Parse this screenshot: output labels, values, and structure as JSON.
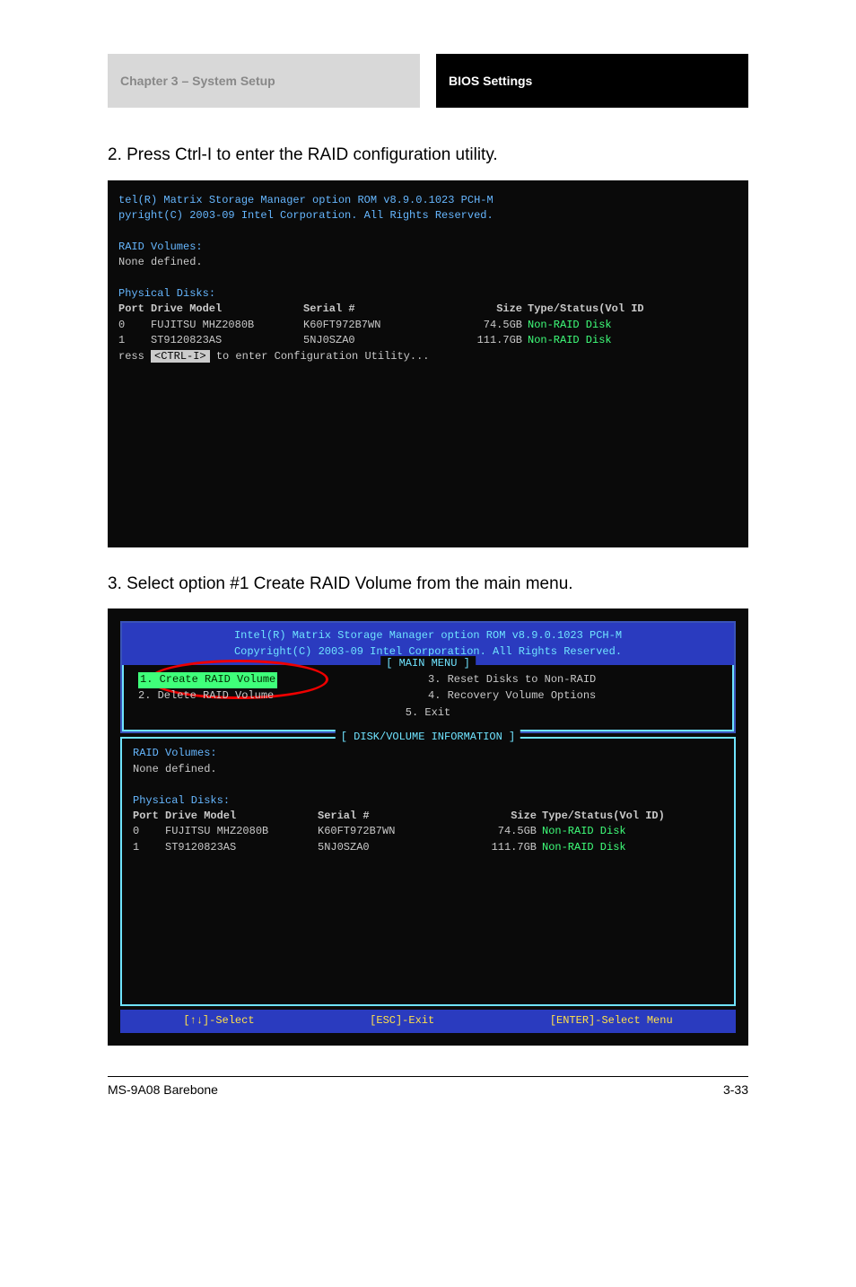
{
  "header": {
    "tab_left": "Chapter 3 – System Setup",
    "tab_right": "BIOS Settings"
  },
  "instructions": {
    "line1": "2. Press Ctrl-I to enter the RAID configuration utility.",
    "line2": "3. Select option #1 Create RAID Volume from the main menu."
  },
  "shot1": {
    "title_l1": "tel(R) Matrix Storage Manager option ROM v8.9.0.1023 PCH-M",
    "title_l2": "pyright(C) 2003-09 Intel Corporation.  All Rights Reserved.",
    "raid_hdr": "RAID Volumes:",
    "raid_none": "None defined.",
    "phys_hdr": "Physical Disks:",
    "th_port": "Port",
    "th_model": "Drive Model",
    "th_serial": "Serial #",
    "th_size": "Size",
    "th_type": "Type/Status(Vol ID",
    "rows": [
      {
        "port": "0",
        "model": "FUJITSU MHZ2080B",
        "serial": "K60FT972B7WN",
        "size": "74.5GB",
        "type": "Non-RAID Disk"
      },
      {
        "port": "1",
        "model": "ST9120823AS",
        "serial": "5NJ0SZA0",
        "size": "111.7GB",
        "type": "Non-RAID Disk"
      }
    ],
    "press_pre": "ress ",
    "press_key": "<CTRL-I>",
    "press_post": " to enter Configuration Utility..."
  },
  "shot2": {
    "banner_l1": "Intel(R) Matrix Storage Manager option ROM v8.9.0.1023 PCH-M",
    "banner_l2": "Copyright(C) 2003-09 Intel Corporation.  All Rights Reserved.",
    "menu_title": "[ MAIN MENU ]",
    "menu_items": {
      "i1": "1.  Create RAID Volume",
      "i2": "2.  Delete RAID Volume",
      "i3": "3.  Reset Disks to Non-RAID",
      "i4": "4.  Recovery Volume Options",
      "i5": "5.  Exit"
    },
    "info_title": "[ DISK/VOLUME INFORMATION ]",
    "raid_hdr": "RAID Volumes:",
    "raid_none": "None defined.",
    "phys_hdr": "Physical Disks:",
    "th_port": "Port",
    "th_model": "Drive Model",
    "th_serial": "Serial #",
    "th_size": "Size",
    "th_type": "Type/Status(Vol ID)",
    "rows": [
      {
        "port": "0",
        "model": "FUJITSU MHZ2080B",
        "serial": "K60FT972B7WN",
        "size": "74.5GB",
        "type": "Non-RAID Disk"
      },
      {
        "port": "1",
        "model": "ST9120823AS",
        "serial": "5NJ0SZA0",
        "size": "111.7GB",
        "type": "Non-RAID Disk"
      }
    ],
    "footer": {
      "select": "[↑↓]-Select",
      "esc": "[ESC]-Exit",
      "enter": "[ENTER]-Select Menu"
    }
  },
  "footer": {
    "manual": "MS-9A08 Barebone",
    "page": "3-33"
  }
}
